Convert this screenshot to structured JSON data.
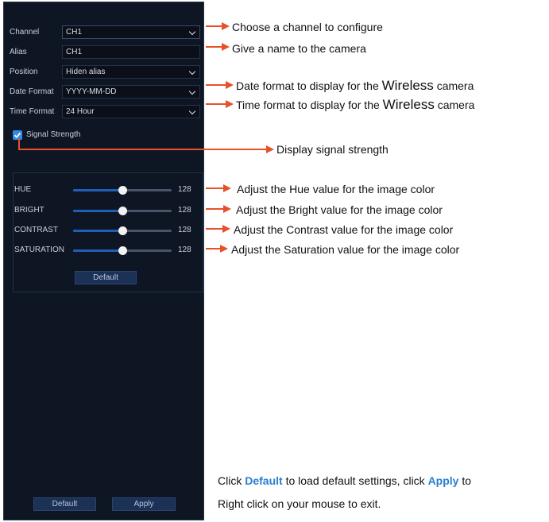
{
  "form": {
    "channel": {
      "label": "Channel",
      "value": "CH1"
    },
    "alias": {
      "label": "Alias",
      "value": "CH1"
    },
    "position": {
      "label": "Position",
      "value": "Hiden alias"
    },
    "date_format": {
      "label": "Date Format",
      "value": "YYYY-MM-DD"
    },
    "time_format": {
      "label": "Time Format",
      "value": "24 Hour"
    },
    "signal_strength": {
      "label": "Signal Strength",
      "checked": true
    }
  },
  "image": {
    "sliders": [
      {
        "label": "HUE",
        "value": "128"
      },
      {
        "label": "BRIGHT",
        "value": "128"
      },
      {
        "label": "CONTRAST",
        "value": "128"
      },
      {
        "label": "SATURATION",
        "value": "128"
      }
    ],
    "default_button": "Default"
  },
  "footer": {
    "default_button": "Default",
    "apply_button": "Apply"
  },
  "annotations": {
    "channel": "Choose a channel to configure",
    "alias": "Give a name to the camera",
    "date_format_pre": "Date format to display for the ",
    "date_format_big": "Wireless",
    "date_format_post": " camera",
    "time_format_pre": "Time format to display for the ",
    "time_format_big": "Wireless",
    "time_format_post": " camera",
    "signal_strength": "Display signal strength",
    "hue": "Adjust the Hue value for the image color",
    "bright": "Adjust the Bright value for the image color",
    "contrast": "Adjust the Contrast value for the image color",
    "saturation": "Adjust the Saturation value for the image color",
    "footer1_a": "Click ",
    "footer1_b": "Default",
    "footer1_c": " to load default settings, click ",
    "footer1_d": "Apply",
    "footer1_e": " to",
    "footer2": "Right click on your mouse to exit."
  },
  "colors": {
    "panel": "#0e1624",
    "accent": "#2d8be6",
    "arrow": "#e8502a",
    "button": "#1c3156"
  }
}
